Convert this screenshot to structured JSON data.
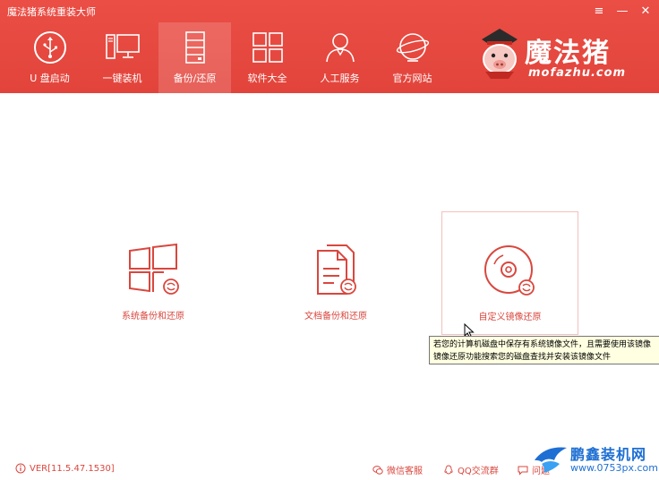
{
  "window": {
    "title": "魔法猪系统重装大师",
    "menu_icon": "≡",
    "minimize_icon": "—",
    "close_icon": "✕"
  },
  "nav": [
    {
      "label": "U 盘启动",
      "icon": "usb-icon"
    },
    {
      "label": "一键装机",
      "icon": "monitor-icon"
    },
    {
      "label": "备份/还原",
      "icon": "server-icon",
      "active": true
    },
    {
      "label": "软件大全",
      "icon": "grid-icon"
    },
    {
      "label": "人工服务",
      "icon": "person-icon"
    },
    {
      "label": "官方网站",
      "icon": "globe-icon"
    }
  ],
  "logo": {
    "text": "魔法猪",
    "sub": "mofazhu.com"
  },
  "cards": [
    {
      "label": "系统备份和还原",
      "icon": "windows-restore-icon"
    },
    {
      "label": "文档备份和还原",
      "icon": "document-restore-icon"
    },
    {
      "label": "自定义镜像还原",
      "icon": "disc-restore-icon",
      "hovered": true
    }
  ],
  "tooltip": {
    "line1": "若您的计算机磁盘中保存有系统镜像文件，且需要使用该镜像",
    "line2": "镜像还原功能搜索您的磁盘查找并安装该镜像文件"
  },
  "footer": {
    "version": "VER[11.5.47.1530]",
    "wechat": "微信客服",
    "qq": "QQ交流群",
    "feedback": "问题"
  },
  "watermark": {
    "text": "鹏鑫装机网",
    "url": "www.0753px.com"
  },
  "colors": {
    "brand": "#e2443b",
    "accent_text": "#d9473e",
    "watermark": "#1e6fd3"
  }
}
